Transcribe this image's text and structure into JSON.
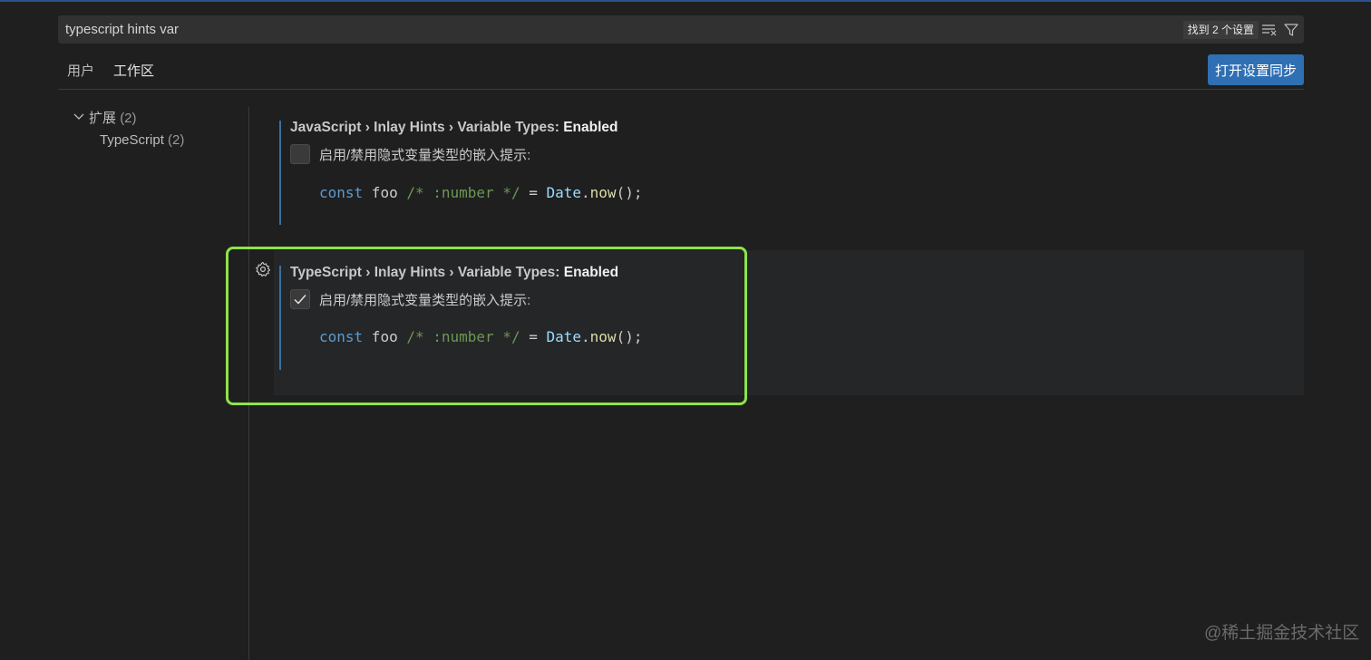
{
  "search": {
    "value": "typescript hints var",
    "result_count": "找到 2 个设置"
  },
  "tabs": [
    {
      "label": "用户",
      "active": false
    },
    {
      "label": "工作区",
      "active": true
    }
  ],
  "sync_button": "打开设置同步",
  "tree": {
    "group_label": "扩展",
    "group_count": "(2)",
    "child_label": "TypeScript",
    "child_count": "(2)"
  },
  "settings": [
    {
      "breadcrumb": "JavaScript › Inlay Hints › Variable Types: ",
      "name": "Enabled",
      "checked": false,
      "description": "启用/禁用隐式变量类型的嵌入提示:",
      "code": {
        "kw": "const",
        "var": " foo ",
        "comment": "/* :number */",
        "eq": " = ",
        "cls": "Date",
        "dot": ".",
        "fn": "now",
        "end": "();"
      }
    },
    {
      "breadcrumb": "TypeScript › Inlay Hints › Variable Types: ",
      "name": "Enabled",
      "checked": true,
      "description": "启用/禁用隐式变量类型的嵌入提示:",
      "code": {
        "kw": "const",
        "var": " foo ",
        "comment": "/* :number */",
        "eq": " = ",
        "cls": "Date",
        "dot": ".",
        "fn": "now",
        "end": "();"
      }
    }
  ],
  "watermark": "@稀土掘金技术社区",
  "colors": {
    "background": "#1f1f1f",
    "accent_button": "#2f6fb3",
    "highlight": "#8fe34a"
  }
}
